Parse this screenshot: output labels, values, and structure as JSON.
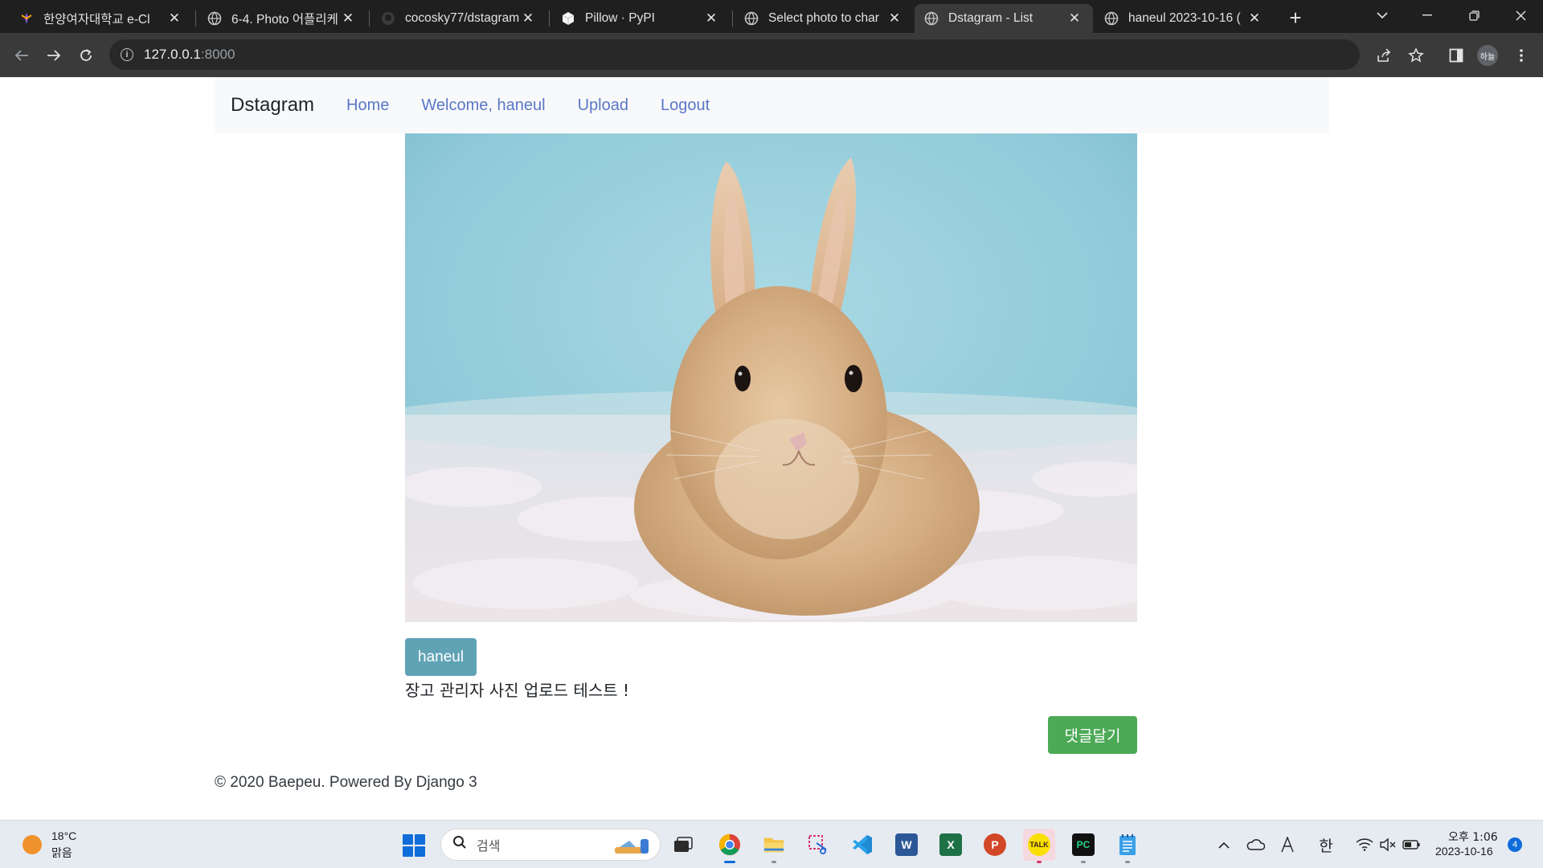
{
  "browser": {
    "tabs": [
      {
        "title": "한양여자대학교 e-Cl",
        "icon": "hywoman-favicon-icon"
      },
      {
        "title": "6-4. Photo 어플리케",
        "icon": "globe-icon"
      },
      {
        "title": "cocosky77/dstagram",
        "icon": "github-icon"
      },
      {
        "title": "Pillow · PyPI",
        "icon": "pypi-icon"
      },
      {
        "title": "Select photo to char",
        "icon": "globe-icon"
      },
      {
        "title": "Dstagram - List",
        "icon": "globe-icon",
        "active": true
      },
      {
        "title": "haneul 2023-10-16 (",
        "icon": "globe-icon"
      }
    ],
    "new_tab_label": "+",
    "url_host": "127.0.0.1",
    "url_port": ":8000",
    "profile_initials": "하늘"
  },
  "page": {
    "navbar": {
      "brand": "Dstagram",
      "links": [
        "Home",
        "Welcome, haneul",
        "Upload",
        "Logout"
      ]
    },
    "post": {
      "image_subject": "rabbit-photo",
      "author": "haneul",
      "caption": "장고 관리자 사진 업로드 테스트 !",
      "comment_button": "댓글달기"
    },
    "footer": "© 2020 Baepeu. Powered By Django 3"
  },
  "taskbar": {
    "weather_temp": "18°C",
    "weather_condition": "맑음",
    "search_placeholder": "검색",
    "apps": [
      "task-view",
      "chrome",
      "file-explorer",
      "snipping-tool",
      "vscode",
      "word",
      "excel",
      "powerpoint",
      "kakaotalk",
      "pycharm",
      "notepad"
    ],
    "active_app": "chrome",
    "input_language": "한",
    "clock_time": "오후 1:06",
    "clock_date": "2023-10-16",
    "notification_count": "4"
  },
  "colors": {
    "link": "#5a77c7",
    "author_badge": "#5fa3b5",
    "comment_button": "#4caa56",
    "tabstrip": "#1f1f1f",
    "toolbar": "#3a3a3a"
  }
}
